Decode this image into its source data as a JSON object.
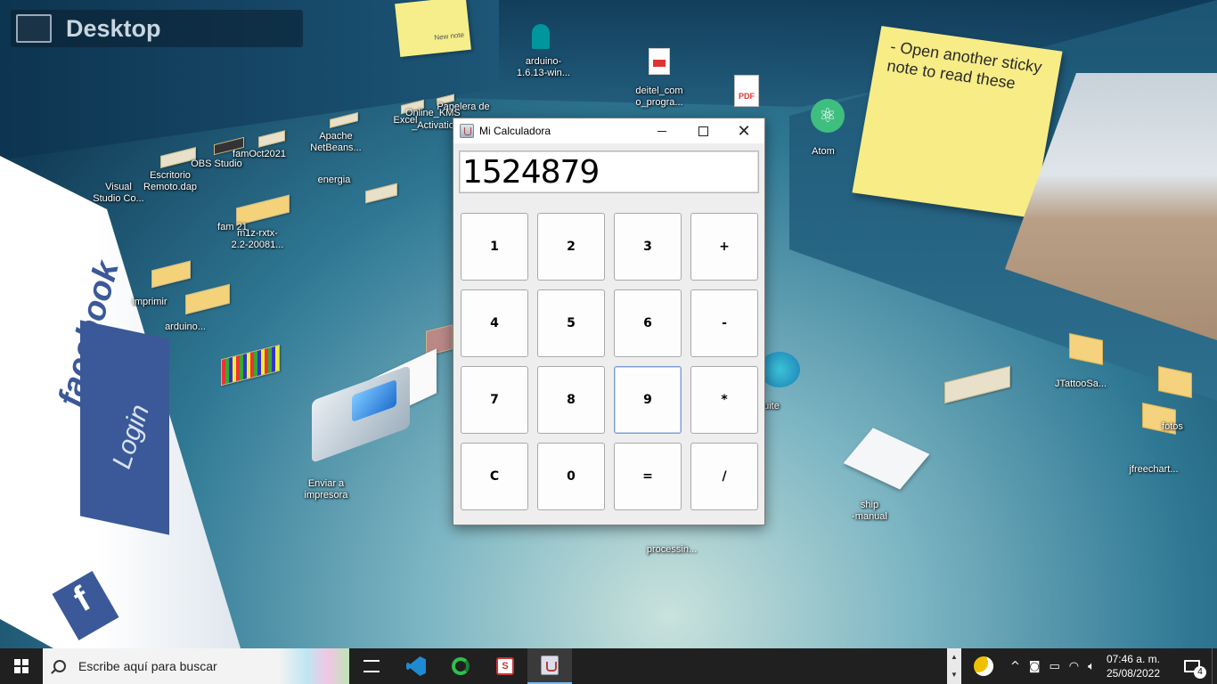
{
  "desktop": {
    "title": "Desktop",
    "sticky_small": "New note",
    "sticky_big": "- Open another sticky note to read these",
    "icons": {
      "arduino_top": "arduino-\n1.6.13-win...",
      "deitel": "deitel_com\no_progra...",
      "atom": "Atom",
      "papelera": "Papelera de",
      "online_kms": "Online_KMS",
      "activatio": "_Activatio",
      "excel": "Excel",
      "apache": "Apache\nNetBeans...",
      "famoct": "famOct2021",
      "obs": "OBS Studio",
      "escritorio": "Escritorio\nRemoto.dap",
      "vscode": "Visual\nStudio Co...",
      "energia": "energia",
      "fam21": "fam 21",
      "m1z": "m1z-rxtx-\n2.2-20081...",
      "imprimir": "imprimir",
      "arduino_low": "arduino...",
      "enviar": "Enviar a\nimpresora",
      "suite": "uite",
      "processing": "processin...",
      "ship": "ship\n-manual",
      "jtattoo": "JTattooSa...",
      "fotos": "fotos",
      "jfreechart": "jfreechart...",
      "facebook": "facebook",
      "login": "Login",
      "pdf": "PDF"
    }
  },
  "calculator": {
    "title": "Mi Calculadora",
    "display": "1524879",
    "keys": [
      "1",
      "2",
      "3",
      "+",
      "4",
      "5",
      "6",
      "-",
      "7",
      "8",
      "9",
      "*",
      "C",
      "0",
      "=",
      "/"
    ],
    "focused_key": "9",
    "close_glyph": "✕"
  },
  "taskbar": {
    "search_placeholder": "Escribe aquí para buscar",
    "time": "07:46 a. m.",
    "date": "25/08/2022",
    "notification_count": "4",
    "redapp_label": "S"
  }
}
